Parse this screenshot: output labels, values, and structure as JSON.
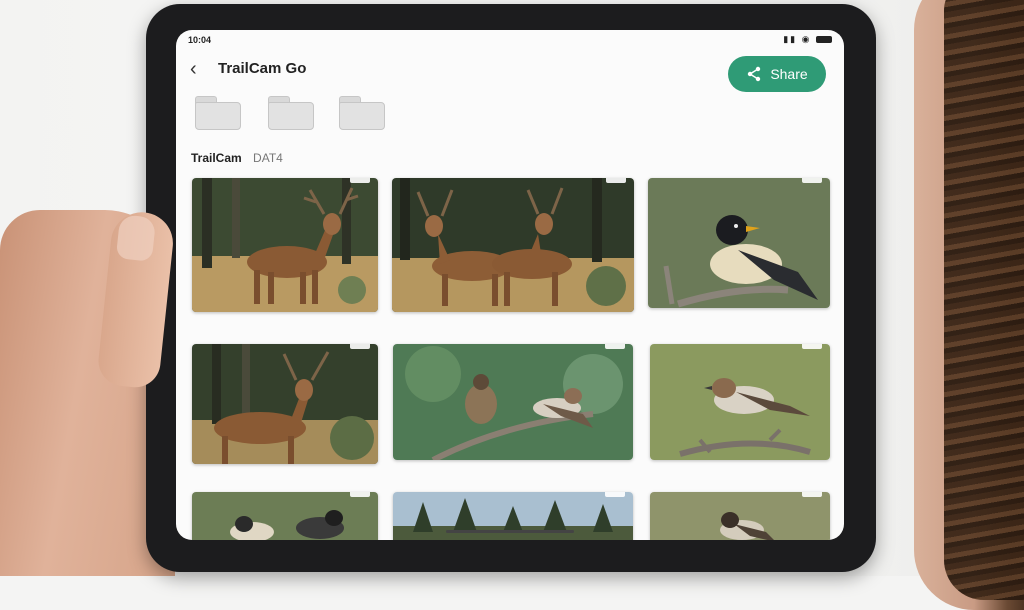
{
  "status_bar": {
    "time": "10:04"
  },
  "header": {
    "title": "TrailCam Go",
    "share_label": "Share"
  },
  "breadcrumb": {
    "main": "TrailCam",
    "sub": "DAT4"
  },
  "photos": [
    {
      "subject": "deer"
    },
    {
      "subject": "two deer"
    },
    {
      "subject": "bird on branch"
    },
    {
      "subject": "deer"
    },
    {
      "subject": "two birds on branch"
    },
    {
      "subject": "bird on branch"
    },
    {
      "subject": "birds"
    },
    {
      "subject": "forest landscape"
    },
    {
      "subject": "bird"
    }
  ],
  "colors": {
    "accent": "#2f9b76",
    "bezel": "#1c1c1e",
    "screen_bg": "#fbfbfb"
  }
}
